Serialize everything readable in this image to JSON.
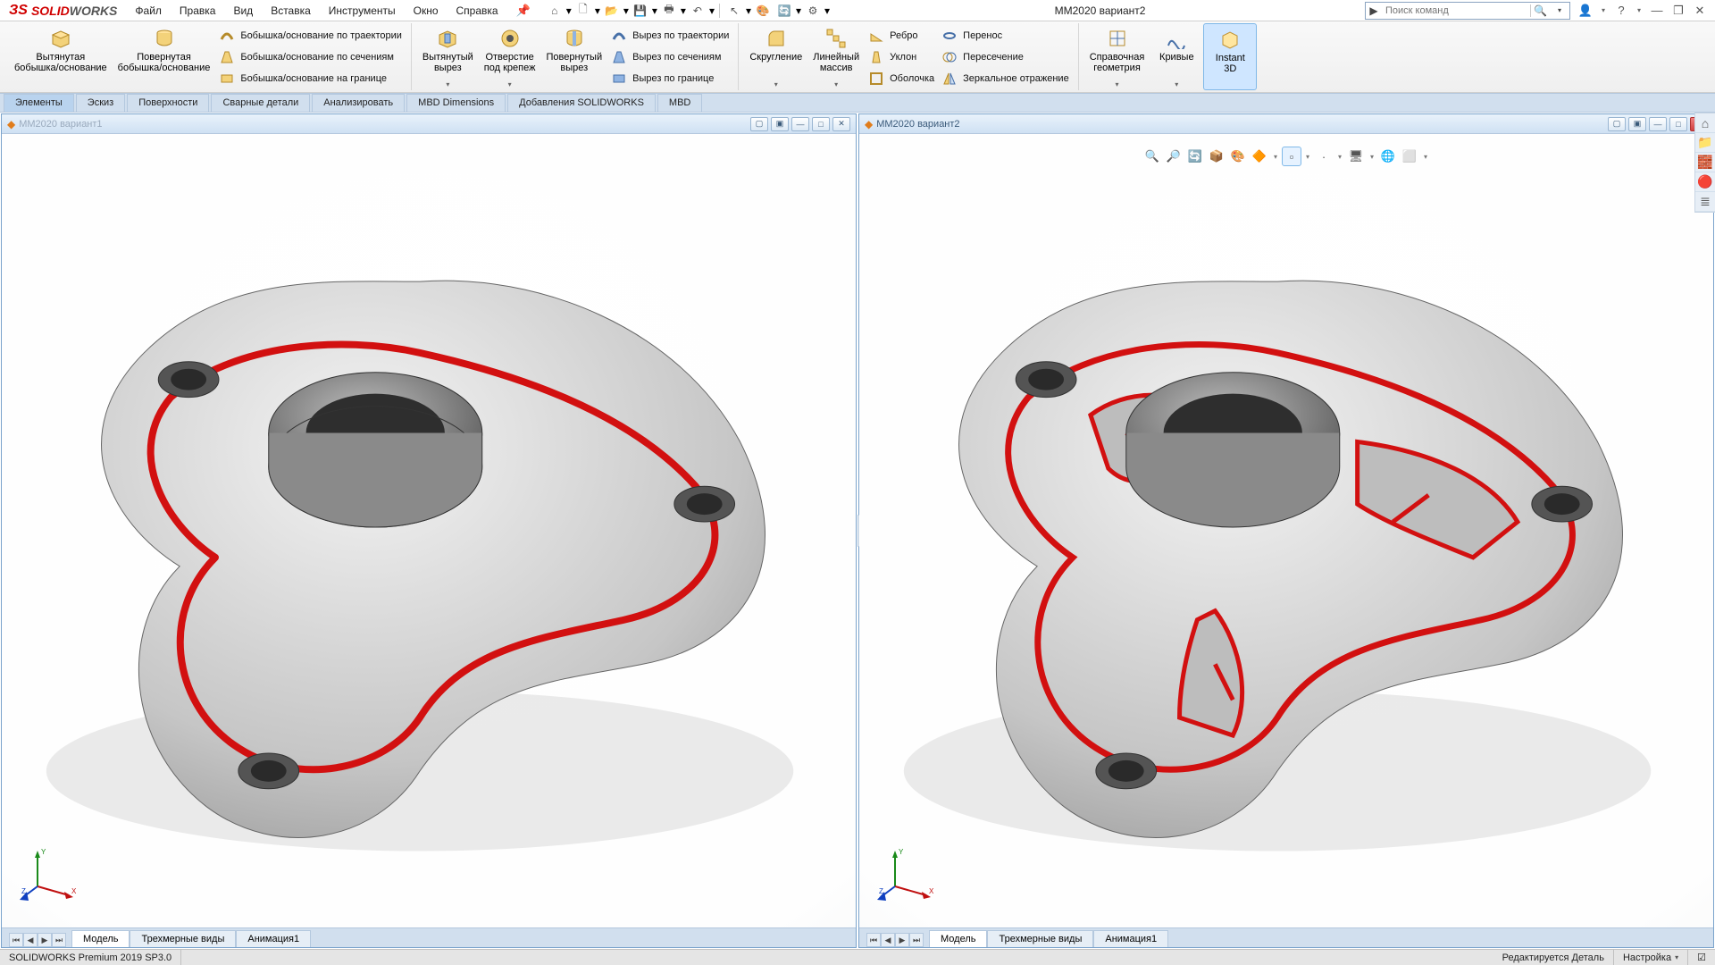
{
  "app": {
    "name_s": "SOLID",
    "name_w": "WORKS",
    "doc_title": "ММ2020 вариант2"
  },
  "menu": [
    "Файл",
    "Правка",
    "Вид",
    "Вставка",
    "Инструменты",
    "Окно",
    "Справка"
  ],
  "search": {
    "placeholder": "Поиск команд"
  },
  "qa": {
    "home": "⌂",
    "new": "🗋",
    "open": "📂",
    "save": "💾",
    "print": "🖶",
    "undo": "↶",
    "select": "↖",
    "colorize": "🎨",
    "rebuild": "🔄",
    "options": "⚙"
  },
  "wc": {
    "user": "👤",
    "help": "?",
    "min": "—",
    "restore": "❐",
    "close": "✕"
  },
  "ribbon": {
    "g1": {
      "boss": {
        "l1": "Вытянутая",
        "l2": "бобышка/основание"
      },
      "revolve": {
        "l1": "Повернутая",
        "l2": "бобышка/основание"
      }
    },
    "g1list": [
      "Бобышка/основание по траектории",
      "Бобышка/основание по сечениям",
      "Бобышка/основание на границе"
    ],
    "g2": {
      "cut": {
        "l1": "Вытянутый",
        "l2": "вырез"
      },
      "hole": {
        "l1": "Отверстие",
        "l2": "под крепеж"
      },
      "rcut": {
        "l1": "Повернутый",
        "l2": "вырез"
      }
    },
    "g2list": [
      "Вырез по траектории",
      "Вырез по сечениям",
      "Вырез по границе"
    ],
    "g3": {
      "fillet": {
        "l1": "Скругление"
      },
      "pattern": {
        "l1": "Линейный",
        "l2": "массив"
      }
    },
    "g3list": [
      "Ребро",
      "Уклон",
      "Оболочка"
    ],
    "g3listB": [
      "Перенос",
      "Пересечение",
      "Зеркальное отражение"
    ],
    "g4": {
      "refgeom": {
        "l1": "Справочная",
        "l2": "геометрия"
      },
      "curves": {
        "l1": "Кривые"
      },
      "instant": {
        "l1": "Instant",
        "l2": "3D"
      }
    }
  },
  "cmdtabs": [
    "Элементы",
    "Эскиз",
    "Поверхности",
    "Сварные детали",
    "Анализировать",
    "MBD Dimensions",
    "Добавления SOLIDWORKS",
    "MBD"
  ],
  "cmdtabs_active": 0,
  "panes": [
    {
      "title": "ММ2020 вариант1",
      "active": false
    },
    {
      "title": "ММ2020 вариант2",
      "active": true
    }
  ],
  "lower_tabs": [
    "Модель",
    "Трехмерные виды",
    "Анимация1"
  ],
  "lower_active": 0,
  "status": {
    "left": "SOLIDWORKS Premium 2019 SP3.0",
    "mid": "Редактируется Деталь",
    "right": "Настройка"
  },
  "hud_icons": [
    "🔍",
    "🔎",
    "🔄",
    "📦",
    "🎨",
    "🔶",
    "▫",
    "·",
    "🖥",
    "🌐",
    "⬜"
  ],
  "side_icons": [
    "⌂",
    "📁",
    "🧱",
    "🔴",
    "≣"
  ]
}
